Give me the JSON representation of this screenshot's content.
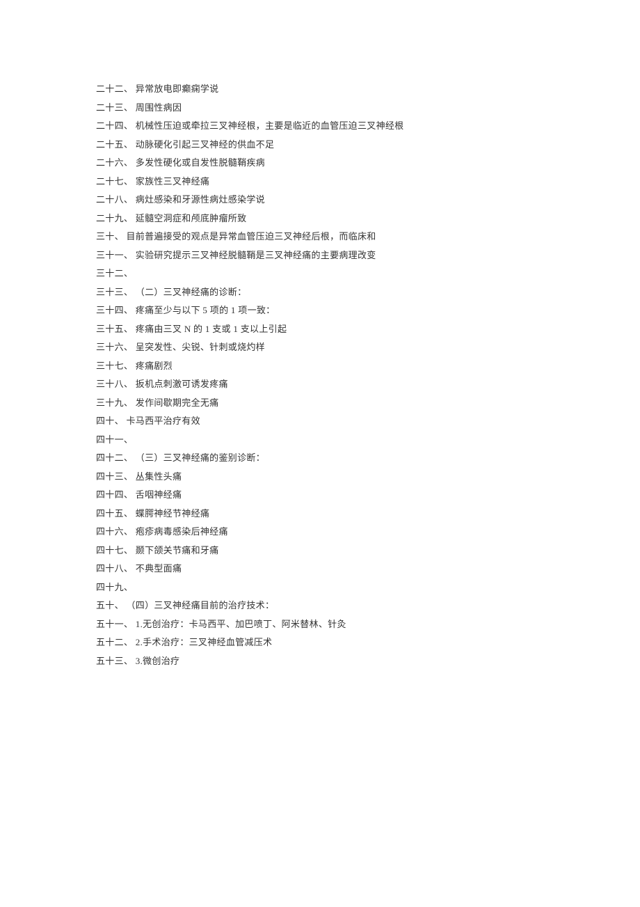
{
  "lines": [
    {
      "num": "二十二、",
      "text": "异常放电即癫痫学说"
    },
    {
      "num": "二十三、",
      "text": "周围性病因"
    },
    {
      "num": "二十四、",
      "text": "机械性压迫或牵拉三叉神经根，主要是临近的血管压迫三叉神经根"
    },
    {
      "num": "二十五、",
      "text": "动脉硬化引起三叉神经的供血不足"
    },
    {
      "num": "二十六、",
      "text": "多发性硬化或自发性脱髓鞘疾病"
    },
    {
      "num": "二十七、",
      "text": "家族性三叉神经痛"
    },
    {
      "num": "二十八、",
      "text": "病灶感染和牙源性病灶感染学说"
    },
    {
      "num": "二十九、",
      "text": "延髓空洞症和颅底肿瘤所致"
    },
    {
      "num": "三十、",
      "text": "目前普遍接受的观点是异常血管压迫三叉神经后根，而临床和"
    },
    {
      "num": "三十一、",
      "text": "实验研究提示三叉神经脱髓鞘是三叉神经痛的主要病理改变"
    },
    {
      "num": "三十二、",
      "text": ""
    },
    {
      "num": "三十三、",
      "text": "（二）三叉神经痛的诊断："
    },
    {
      "num": "三十四、",
      "text": "疼痛至少与以下 5 项的 1 项一致："
    },
    {
      "num": "三十五、",
      "text": "疼痛由三叉 N 的 1 支或 1 支以上引起"
    },
    {
      "num": "三十六、",
      "text": "呈突发性、尖锐、针刺或烧灼样"
    },
    {
      "num": "三十七、",
      "text": "疼痛剧烈"
    },
    {
      "num": "三十八、",
      "text": "扳机点刺激可诱发疼痛"
    },
    {
      "num": "三十九、",
      "text": "发作间歇期完全无痛"
    },
    {
      "num": "四十、",
      "text": "卡马西平治疗有效"
    },
    {
      "num": "四十一、",
      "text": ""
    },
    {
      "num": "四十二、",
      "text": "（三）三叉神经痛的鉴别诊断："
    },
    {
      "num": "四十三、",
      "text": "丛集性头痛"
    },
    {
      "num": "四十四、",
      "text": "舌咽神经痛"
    },
    {
      "num": "四十五、",
      "text": "蝶腭神经节神经痛"
    },
    {
      "num": "四十六、",
      "text": "疱疹病毒感染后神经痛"
    },
    {
      "num": "四十七、",
      "text": "颞下颌关节痛和牙痛"
    },
    {
      "num": "四十八、",
      "text": "不典型面痛"
    },
    {
      "num": "四十九、",
      "text": ""
    },
    {
      "num": "五十、",
      "text": "（四）三叉神经痛目前的治疗技术："
    },
    {
      "num": "五十一、",
      "text": "1.无创治疗：卡马西平、加巴喷丁、阿米替林、针灸"
    },
    {
      "num": "五十二、",
      "text": "2.手术治疗：三叉神经血管减压术"
    },
    {
      "num": "五十三、",
      "text": "3.微创治疗"
    }
  ]
}
